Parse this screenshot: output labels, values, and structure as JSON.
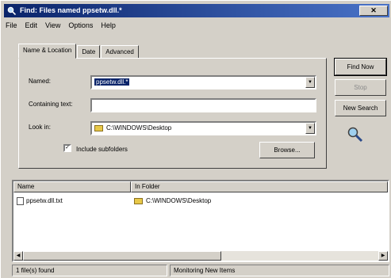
{
  "window": {
    "title": "Find: Files named ppsetw.dll.*",
    "close_label": "✕"
  },
  "menu": [
    "File",
    "Edit",
    "View",
    "Options",
    "Help"
  ],
  "tabs": [
    "Name & Location",
    "Date",
    "Advanced"
  ],
  "form": {
    "named_label": "Named:",
    "named_value": "ppsetw.dll.*",
    "containing_label": "Containing text:",
    "containing_value": "",
    "lookin_label": "Look in:",
    "lookin_value": "C:\\WINDOWS\\Desktop",
    "subfolders_label": "Include subfolders",
    "subfolders_checked": true,
    "browse_label": "Browse..."
  },
  "buttons": {
    "find_now": "Find Now",
    "stop": "Stop",
    "new_search": "New Search"
  },
  "results": {
    "columns": [
      "Name",
      "In Folder"
    ],
    "rows": [
      {
        "name": "ppsetw.dll.txt",
        "folder": "C:\\WINDOWS\\Desktop"
      }
    ]
  },
  "status": {
    "count": "1 file(s) found",
    "message": "Monitoring New Items"
  }
}
